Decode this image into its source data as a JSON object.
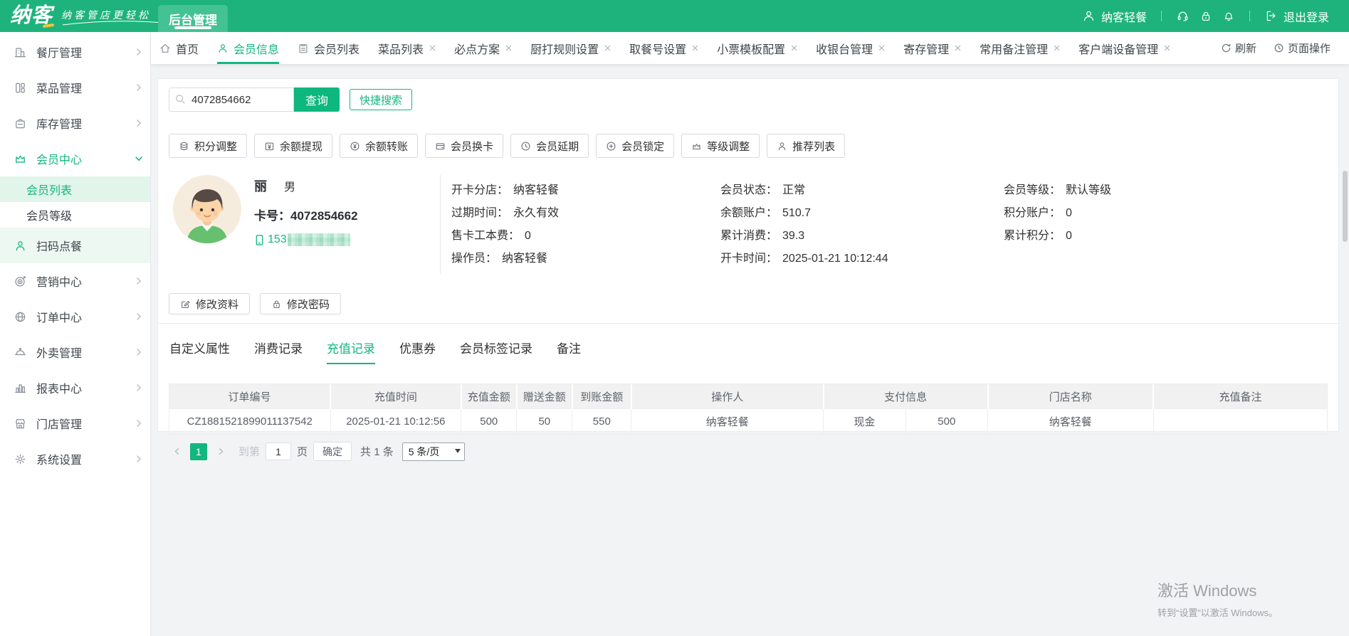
{
  "colors": {
    "brand_green": "#12b77f",
    "header_green": "#1eb37c",
    "header_tab_green": "#43c294",
    "accent_button_green": "#0db77d",
    "light_green_bg": "#e1f5eb",
    "soft_green_bg": "#edf8f3",
    "content_bg": "#f2f3f4",
    "table_header_bg": "#f1f1f1",
    "border_grey": "#e9ebee",
    "text_dark": "#303133",
    "text_grey": "#5f646c",
    "disabled_grey": "#bdc2c9",
    "watermark_grey": "#9da2a6",
    "logo_accent_yellow": "#f5c531"
  },
  "header": {
    "logo_text": "纳客",
    "slogan": "纳客管店更轻松",
    "nav_tab": "后台管理",
    "user_name": "纳客轻餐",
    "logout_label": "退出登录",
    "icons": [
      "user-icon",
      "headset-icon",
      "lock-icon",
      "bell-icon",
      "logout-icon"
    ]
  },
  "tabbar": {
    "tabs": [
      {
        "label": "首页",
        "icon": "home-icon",
        "closable": false,
        "active": false
      },
      {
        "label": "会员信息",
        "icon": "user-icon",
        "closable": false,
        "active": true
      },
      {
        "label": "会员列表",
        "icon": "list-icon",
        "closable": false,
        "active": false
      },
      {
        "label": "菜品列表",
        "closable": true,
        "active": false
      },
      {
        "label": "必点方案",
        "closable": true,
        "active": false
      },
      {
        "label": "厨打规则设置",
        "closable": true,
        "active": false
      },
      {
        "label": "取餐号设置",
        "closable": true,
        "active": false
      },
      {
        "label": "小票模板配置",
        "closable": true,
        "active": false
      },
      {
        "label": "收银台管理",
        "closable": true,
        "active": false
      },
      {
        "label": "寄存管理",
        "closable": true,
        "active": false
      },
      {
        "label": "常用备注管理",
        "closable": true,
        "active": false
      },
      {
        "label": "客户端设备管理",
        "closable": true,
        "active": false
      }
    ],
    "refresh_label": "刷新",
    "page_ops_label": "页面操作"
  },
  "sidebar": {
    "items": [
      {
        "label": "餐厅管理",
        "icon": "restaurant-icon",
        "expandable": true
      },
      {
        "label": "菜品管理",
        "icon": "dishes-icon",
        "expandable": true
      },
      {
        "label": "库存管理",
        "icon": "inventory-icon",
        "expandable": true
      },
      {
        "label": "会员中心",
        "icon": "crown-icon",
        "expandable": true,
        "expanded": true,
        "active": true,
        "children": [
          {
            "label": "会员列表",
            "active": true
          },
          {
            "label": "会员等级",
            "active": false
          }
        ]
      },
      {
        "label": "扫码点餐",
        "icon": "scan-order-icon",
        "highlighted": true
      },
      {
        "label": "营销中心",
        "icon": "marketing-icon",
        "expandable": true
      },
      {
        "label": "订单中心",
        "icon": "order-icon",
        "expandable": true
      },
      {
        "label": "外卖管理",
        "icon": "takeout-icon",
        "expandable": true
      },
      {
        "label": "报表中心",
        "icon": "report-icon",
        "expandable": true
      },
      {
        "label": "门店管理",
        "icon": "store-icon",
        "expandable": true
      },
      {
        "label": "系统设置",
        "icon": "settings-icon",
        "expandable": true
      }
    ]
  },
  "search": {
    "value": "4072854662",
    "query_label": "查询",
    "quick_label": "快捷搜索"
  },
  "member_actions": [
    {
      "label": "积分调整",
      "icon": "points-icon"
    },
    {
      "label": "余额提现",
      "icon": "withdraw-icon"
    },
    {
      "label": "余额转账",
      "icon": "transfer-icon"
    },
    {
      "label": "会员换卡",
      "icon": "change-card-icon"
    },
    {
      "label": "会员延期",
      "icon": "extend-icon"
    },
    {
      "label": "会员锁定",
      "icon": "lock-member-icon"
    },
    {
      "label": "等级调整",
      "icon": "level-icon"
    },
    {
      "label": "推荐列表",
      "icon": "referral-icon"
    }
  ],
  "member": {
    "name": "丽",
    "gender": "男",
    "card_label": "卡号：",
    "card_no": "4072854662",
    "phone_prefix": "153",
    "info_col1": [
      {
        "label": "开卡分店：",
        "value": "纳客轻餐"
      },
      {
        "label": "过期时间：",
        "value": "永久有效"
      },
      {
        "label": "售卡工本费：",
        "value": "0"
      },
      {
        "label": "操作员：",
        "value": "纳客轻餐"
      }
    ],
    "info_col2": [
      {
        "label": "会员状态：",
        "value": "正常"
      },
      {
        "label": "余额账户：",
        "value": "510.7"
      },
      {
        "label": "累计消费：",
        "value": "39.3"
      },
      {
        "label": "开卡时间：",
        "value": "2025-01-21 10:12:44"
      }
    ],
    "info_col3": [
      {
        "label": "会员等级：",
        "value": "默认等级"
      },
      {
        "label": "积分账户：",
        "value": "0"
      },
      {
        "label": "累计积分：",
        "value": "0"
      }
    ],
    "edit_profile_label": "修改资料",
    "edit_password_label": "修改密码"
  },
  "subtabs": {
    "items": [
      "自定义属性",
      "消费记录",
      "充值记录",
      "优惠券",
      "会员标签记录",
      "备注"
    ],
    "active": "充值记录"
  },
  "table": {
    "headers": [
      "订单编号",
      "充值时间",
      "充值金额",
      "赠送金额",
      "到账金额",
      "操作人",
      "支付信息",
      "门店名称",
      "充值备注"
    ],
    "rows": [
      {
        "order_no": "CZ1881521899011137542",
        "time": "2025-01-21 10:12:56",
        "amount": "500",
        "gift": "50",
        "received": "550",
        "operator": "纳客轻餐",
        "pay_type": "现金",
        "pay_amount": "500",
        "store": "纳客轻餐",
        "remark": ""
      }
    ]
  },
  "pagination": {
    "page": "1",
    "goto_label": "到第",
    "goto_value": "1",
    "unit_label": "页",
    "confirm_label": "确定",
    "total_label": "共 1 条",
    "size_option": "5 条/页"
  },
  "watermark": {
    "line1": "激活 Windows",
    "line2": "转到“设置”以激活 Windows。"
  }
}
